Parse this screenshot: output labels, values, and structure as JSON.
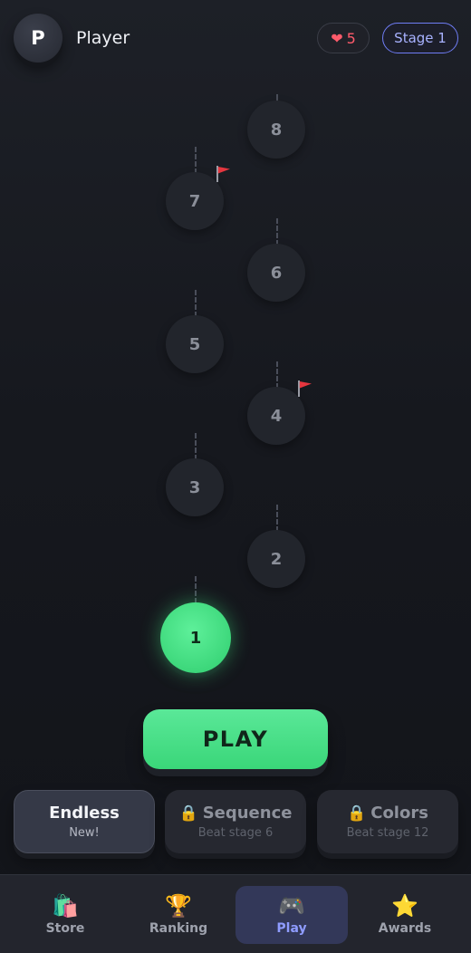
{
  "header": {
    "avatar_letter": "P",
    "player_name": "Player",
    "hearts_icon": "heart-icon",
    "hearts_count": "5",
    "stage_label": "Stage 1"
  },
  "map": {
    "current_level": "1",
    "levels": [
      "1",
      "2",
      "3",
      "4",
      "5",
      "6",
      "7",
      "8"
    ],
    "flag_icon": "red-flag-icon",
    "flagged_levels": [
      "4",
      "7"
    ]
  },
  "play_button": {
    "label": "PLAY"
  },
  "modes": [
    {
      "title": "Endless",
      "subtitle": "New!",
      "locked": false,
      "icon": ""
    },
    {
      "title": "Sequence",
      "subtitle": "Beat stage 6",
      "locked": true,
      "icon": "🔒"
    },
    {
      "title": "Colors",
      "subtitle": "Beat stage 12",
      "locked": true,
      "icon": "🔒"
    }
  ],
  "nav": {
    "active": "Play",
    "items": [
      {
        "label": "Store",
        "icon": "🛍️",
        "icon_name": "shopping-bags-icon"
      },
      {
        "label": "Ranking",
        "icon": "🏆",
        "icon_name": "trophy-icon"
      },
      {
        "label": "Play",
        "icon": "🎮",
        "icon_name": "game-controller-icon"
      },
      {
        "label": "Awards",
        "icon": "⭐",
        "icon_name": "star-icon"
      }
    ]
  },
  "colors": {
    "background": "#17191f",
    "accent_green": "#3ad679",
    "accent_blue": "#8f9cff",
    "hearts_red": "#ff5b6b"
  }
}
